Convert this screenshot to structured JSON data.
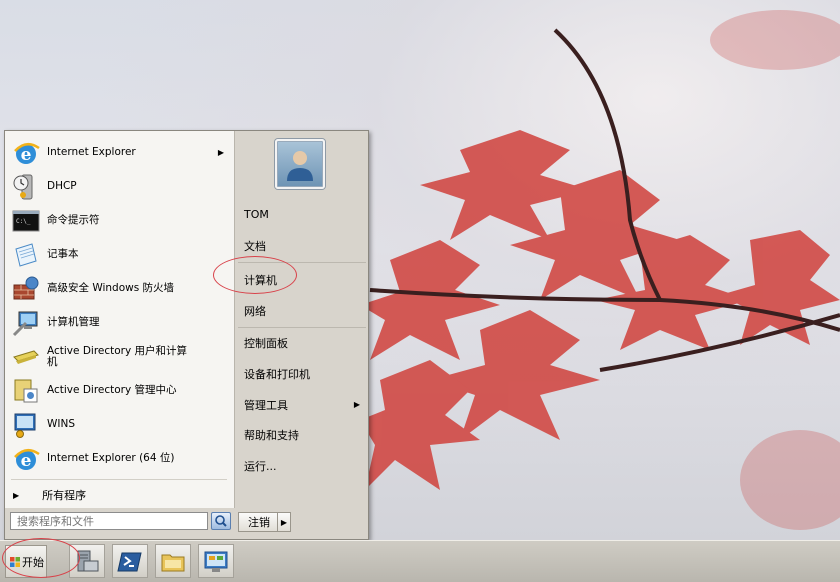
{
  "start_menu": {
    "programs": [
      {
        "label": "Internet Explorer",
        "icon": "internet-explorer-icon",
        "has_submenu": true
      },
      {
        "label": "DHCP",
        "icon": "dhcp-icon",
        "has_submenu": false
      },
      {
        "label": "命令提示符",
        "icon": "command-prompt-icon",
        "has_submenu": false
      },
      {
        "label": "记事本",
        "icon": "notepad-icon",
        "has_submenu": false
      },
      {
        "label": "高级安全 Windows 防火墙",
        "icon": "firewall-icon",
        "has_submenu": false
      },
      {
        "label": "计算机管理",
        "icon": "computer-management-icon",
        "has_submenu": false
      },
      {
        "label": "Active Directory 用户和计算机",
        "icon": "ad-users-icon",
        "has_submenu": false
      },
      {
        "label": "Active Directory 管理中心",
        "icon": "ad-admin-center-icon",
        "has_submenu": false
      },
      {
        "label": "WINS",
        "icon": "wins-icon",
        "has_submenu": false
      },
      {
        "label": "Internet Explorer (64 位)",
        "icon": "internet-explorer-icon",
        "has_submenu": false
      }
    ],
    "all_programs": "所有程序",
    "search_placeholder": "搜索程序和文件",
    "places": [
      {
        "label": "TOM",
        "has_submenu": false
      },
      {
        "label": "文档",
        "has_submenu": false
      },
      {
        "label": "计算机",
        "has_submenu": false
      },
      {
        "label": "网络",
        "has_submenu": false
      },
      {
        "label": "控制面板",
        "has_submenu": false
      },
      {
        "label": "设备和打印机",
        "has_submenu": false
      },
      {
        "label": "管理工具",
        "has_submenu": true
      },
      {
        "label": "帮助和支持",
        "has_submenu": false
      },
      {
        "label": "运行...",
        "has_submenu": false
      }
    ],
    "logoff_label": "注销"
  },
  "taskbar": {
    "start_label": "开始",
    "quick_launch": [
      "server-manager-icon",
      "powershell-icon",
      "explorer-icon",
      "control-panel-icon"
    ]
  },
  "colors": {
    "annotation": "#d8424a",
    "desktop": "#dcdee6",
    "menu_bg": "#d8d4cc"
  }
}
